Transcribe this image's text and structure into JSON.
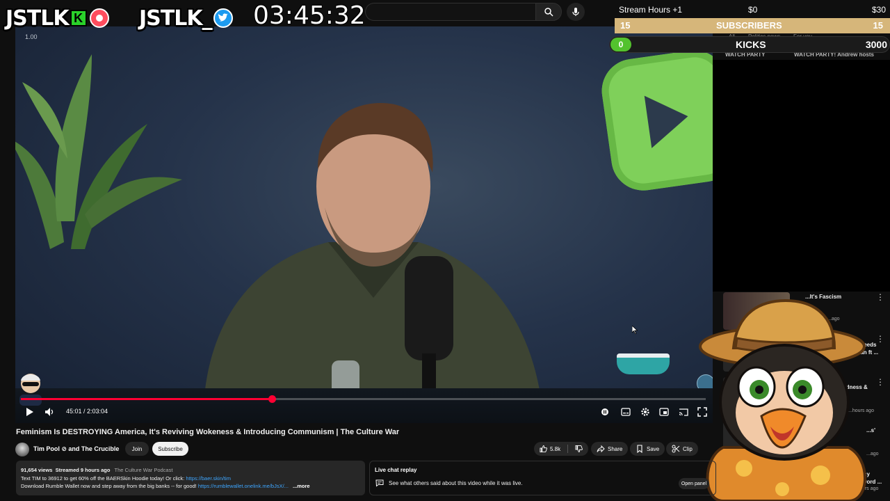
{
  "overlay": {
    "brand_left": "JSTLK",
    "brand_left_icon": "kick-icon",
    "brand_right": "JSTLK_",
    "brand_right_icon": "twitter-icon",
    "clock": "03:45:32"
  },
  "goals": {
    "stream_hours": {
      "label": "Stream Hours +1",
      "current": "$0",
      "target": "$30",
      "progress": 0.0
    },
    "subscribers": {
      "left": "15",
      "label": "SUBSCRIBERS",
      "right": "15"
    },
    "kicks": {
      "current": "0",
      "label": "KICKS",
      "target": "3000"
    }
  },
  "behind": {
    "chips": [
      "All",
      "Politics news",
      "For you"
    ],
    "watch_party": [
      "WATCH PARTY",
      "WATCH PARTY! Andrew hosts"
    ]
  },
  "player": {
    "speed": "1.00",
    "time": "45:01 / 2:03:04",
    "progress": 0.366,
    "colors": {
      "played": "#ff0033",
      "accent_green": "#7fd05a"
    }
  },
  "video": {
    "title": "Feminism Is DESTROYING America, It's Reviving Wokeness & Introducing Communism | The Culture War",
    "channel": "Tim Pool ⊘ and The Crucible",
    "join": "Join",
    "subscribe": "Subscribe",
    "likes": "5.8k",
    "share": "Share",
    "save": "Save",
    "clip": "Clip"
  },
  "description": {
    "views": "91,654 views",
    "streamed": "Streamed 9 hours ago",
    "channel_tag": "The Culture War Podcast",
    "line2_text": "Text TIM to 36912 to get 60% off the BAERSkin Hoodie today! Or click: ",
    "line2_link": "https://baer.skin/tim",
    "line3_text": "Download Rumble Wallet now and step away from the big banks -- for good! ",
    "line3_link": "https://rumblewallet.onelink.me/bJsX/...",
    "more": "...more"
  },
  "live_chat": {
    "title": "Live chat replay",
    "subtitle": "See what others said about this video while it was live.",
    "open": "Open panel"
  },
  "recommendations": [
    {
      "title": "...It's Fascism",
      "meta": "...ago"
    },
    {
      "title": "Spidey Needs Kingsman ft ...",
      "meta": ""
    },
    {
      "title": "...dness &",
      "meta": "...hours ago"
    },
    {
      "title": "...s'",
      "meta": "...ago"
    },
    {
      "title": "...dline in Nancy ...passes, no word ...",
      "meta": "CTV News ⊘ · 20k views · 5 hours ago"
    }
  ]
}
